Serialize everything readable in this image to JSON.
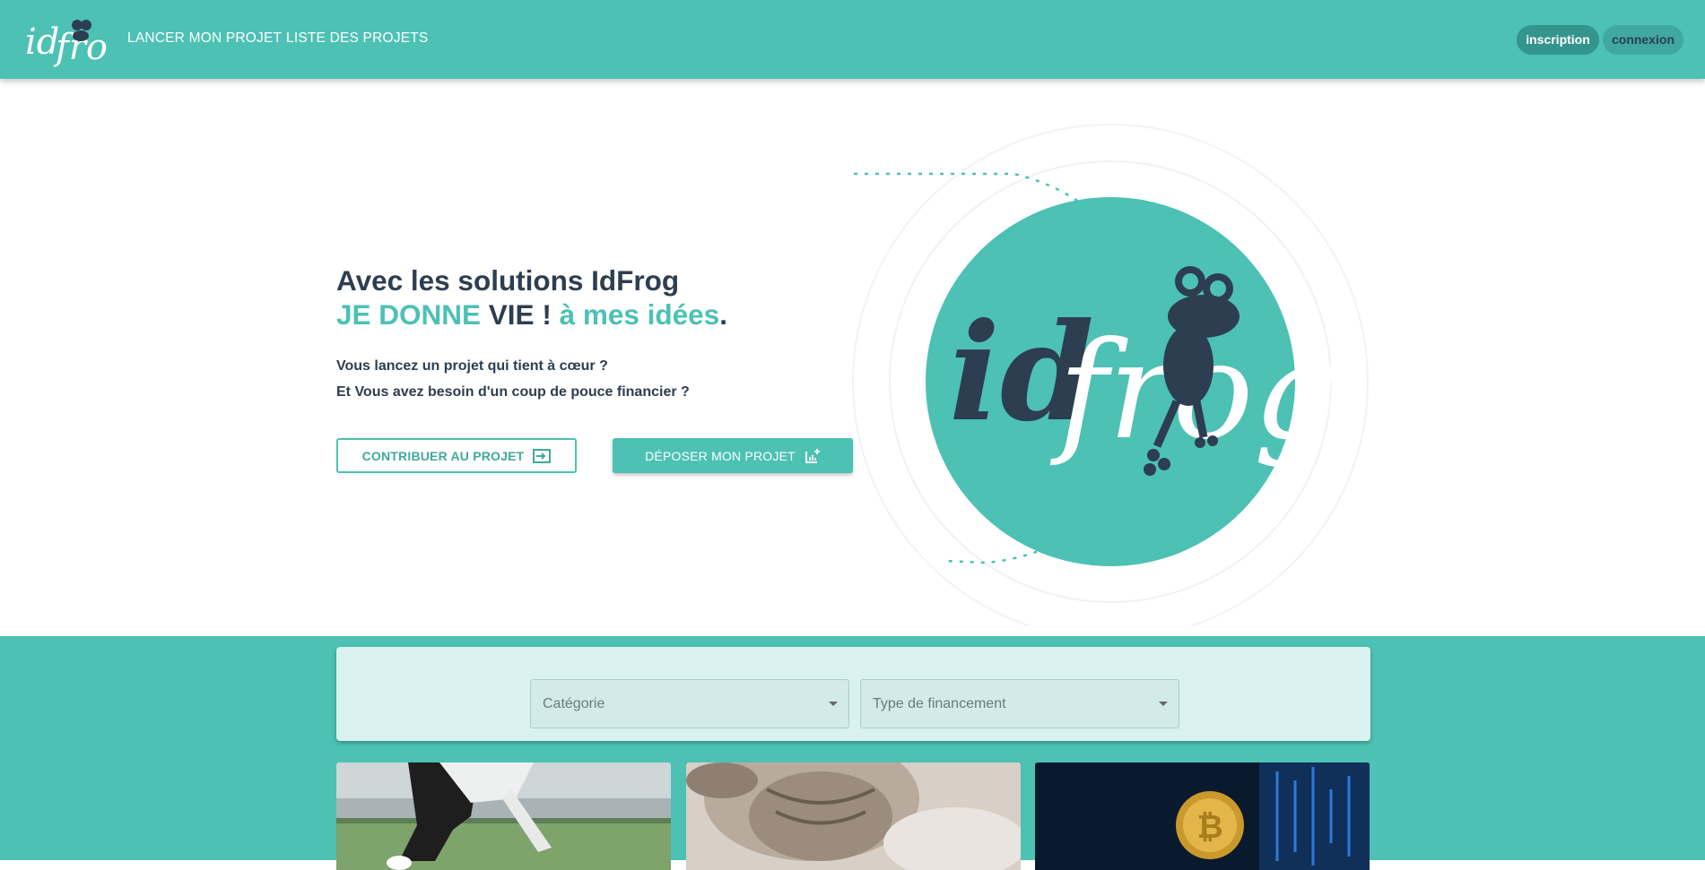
{
  "brand": {
    "logo_text": "idfrog",
    "accent": "#4cc1b4",
    "dark": "#2d3e50"
  },
  "nav": {
    "links": [
      {
        "label": "LANCER MON PROJET"
      },
      {
        "label": "LISTE DES PROJETS"
      }
    ],
    "signup_label": "inscription",
    "login_label": "connexion"
  },
  "hero": {
    "title_line1": "Avec les solutions IdFrog",
    "title_line2": {
      "part1": "JE DONNE",
      "part2": " VIE ! ",
      "part3": "à mes idées",
      "part4": "."
    },
    "subtitle_line1": "Vous lancez un projet qui tient à cœur ?",
    "subtitle_line2": "Et Vous avez besoin d'un coup de pouce financier ?",
    "contribute_button": "CONTRIBUER AU PROJET",
    "submit_button": "DÉPOSER MON PROJET",
    "graphic_text": "idfrog"
  },
  "filters": {
    "category": {
      "placeholder": "Catégorie"
    },
    "funding_type": {
      "placeholder": "Type de financement"
    }
  },
  "projects": [
    {
      "image": "athlete-photo"
    },
    {
      "image": "kitten-photo"
    },
    {
      "image": "bitcoin-photo"
    }
  ]
}
